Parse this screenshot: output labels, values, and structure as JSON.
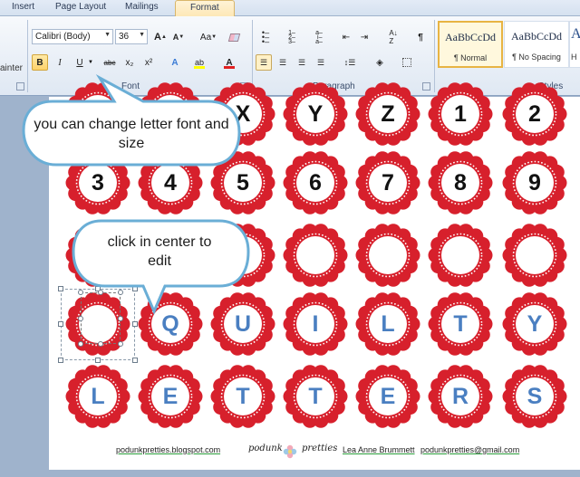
{
  "ribbon": {
    "tabs": [
      "Insert",
      "Page Layout",
      "Mailings",
      "Format"
    ],
    "font": {
      "family": "Calibri (Body)",
      "size": "36",
      "grow_label": "A",
      "shrink_label": "A",
      "case_label": "Aa",
      "bold": "B",
      "italic": "I",
      "underline": "U",
      "strike": "abc",
      "subscript": "x₂",
      "superscript": "x²",
      "highlight": "ab",
      "font_color": "A",
      "label": "Font",
      "highlight_color": "#ffff00",
      "font_color_value": "#e02020"
    },
    "painter_label": "ainter",
    "paragraph": {
      "label": "Paragraph"
    },
    "styles": {
      "label": "Styles",
      "items": [
        {
          "sample": "AaBbCcDd",
          "name": "¶ Normal"
        },
        {
          "sample": "AaBbCcDd",
          "name": "¶ No Spacing"
        },
        {
          "sample": "A",
          "name": "H"
        }
      ]
    }
  },
  "document": {
    "rows": [
      [
        "",
        "",
        "X",
        "Y",
        "Z",
        "1",
        "2"
      ],
      [
        "3",
        "4",
        "5",
        "6",
        "7",
        "8",
        "9"
      ],
      [
        "",
        "",
        "",
        "",
        "",
        "",
        ""
      ],
      [
        "",
        "Q",
        "U",
        "I",
        "L",
        "T",
        "Y"
      ],
      [
        "L",
        "E",
        "T",
        "T",
        "E",
        "R",
        "S"
      ]
    ],
    "row_styles": [
      "black",
      "black",
      "black",
      "blue",
      "blue"
    ],
    "scallop_color": "#d7202c",
    "footer": {
      "blog": "podunkpretties.blogspot.com",
      "logo_left": "podunk",
      "logo_right": "pretties",
      "name": "Lea Anne Brummett",
      "email": "podunkpretties@gmail.com"
    }
  },
  "callouts": {
    "font_tip": "you can change letter font and size",
    "center_tip": "click in center to edit"
  }
}
